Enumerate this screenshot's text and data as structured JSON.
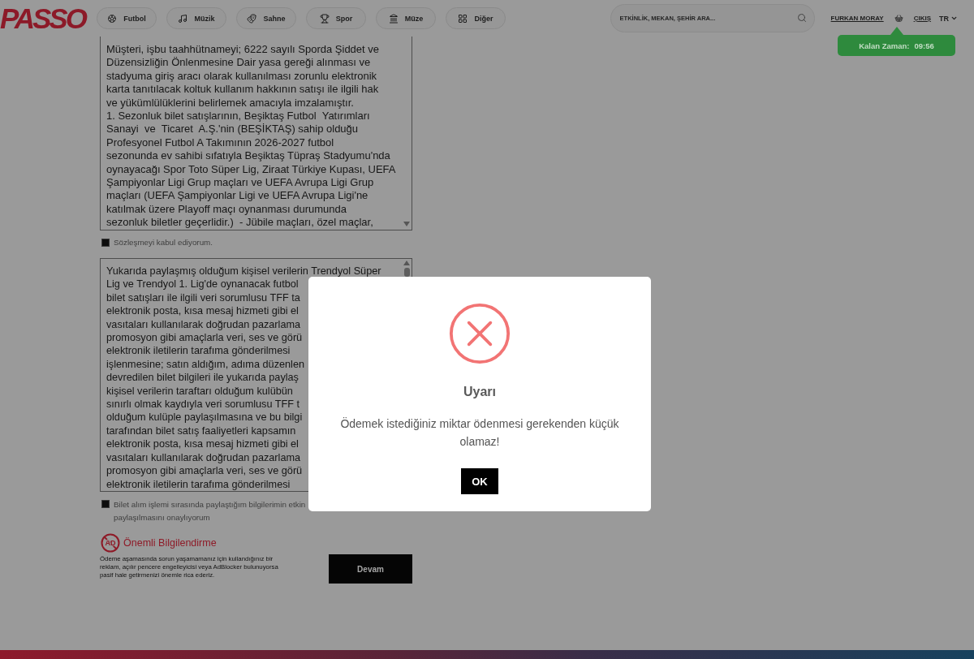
{
  "header": {
    "logo": "PASSO",
    "categories": [
      {
        "kind": "football",
        "label": "Futbol"
      },
      {
        "kind": "music",
        "label": "Müzik"
      },
      {
        "kind": "stage",
        "label": "Sahne"
      },
      {
        "kind": "sport",
        "label": "Spor"
      },
      {
        "kind": "museum",
        "label": "Müze"
      },
      {
        "kind": "other",
        "label": "Diğer"
      }
    ],
    "search": {
      "placeholder": "ETKİNLİK, MEKAN, ŞEHİR ARA..."
    },
    "user": "FURKAN MORAY",
    "logout": "ÇIKIŞ",
    "language": "TR"
  },
  "timer": {
    "label": "Kalan Zaman:",
    "value": "09:56"
  },
  "contract": {
    "lines": [
      "Müşteri, işbu taahhütnameyi; 6222 sayılı Sporda Şiddet ve",
      "Düzensizliğin Önlenmesine Dair yasa gereği alınması ve",
      "stadyuma giriş aracı olarak kullanılması zorunlu elektronik",
      "karta tanıtılacak koltuk kullanım hakkının satışı ile ilgili hak",
      "ve yükümlülüklerini belirlemek amacıyla imzalamıştır.",
      "1. Sezonluk bilet satışlarının, Beşiktaş Futbol  Yatırımları",
      "Sanayi  ve  Ticaret  A.Ş.'nin (BEŞİKTAŞ) sahip olduğu",
      "Profesyonel Futbol A Takımının 2026-2027 futbol",
      "sezonunda ev sahibi sıfatıyla Beşiktaş Tüpraş Stadyumu'nda",
      "oynayacağı Spor Toto Süper Lig, Ziraat Türkiye Kupası, UEFA",
      "Şampiyonlar Ligi Grup maçları ve UEFA Avrupa Ligi Grup",
      "maçları (UEFA Şampiyonlar Ligi ve UEFA Avrupa Ligi'ne",
      "katılmak üzere Playoff maçı oynanması durumunda",
      "sezonluk biletler geçerlidir.)  - Jübile maçları, özel maçlar,"
    ],
    "checkbox": {
      "label_lines": [
        "Sözleşmeyi kabul ediyorum."
      ],
      "checked": false
    }
  },
  "consent": {
    "lines": [
      "Yukarıda paylaşmış olduğum kişisel verilerin Trendyol Süper",
      "Lig ve Trendyol 1. Lig'de oynanacak futbol",
      "bilet satışları ile ilgili veri sorumlusu TFF ta",
      "elektronik posta, kısa mesaj hizmeti gibi el",
      "vasıtaları kullanılarak doğrudan pazarlama",
      "promosyon gibi amaçlarla veri, ses ve görü",
      "elektronik iletilerin tarafıma gönderilmesi",
      "işlenmesine; satın aldığım, adıma düzenlen",
      "devredilen bilet bilgileri ile yukarıda paylaş",
      "kişisel verilerin taraftarı olduğum kulübün",
      "sınırlı olmak kaydıyla veri sorumlusu TFF t",
      "olduğum kulüple paylaşılmasına ve bu bilgi",
      "tarafından bilet satış faaliyetleri kapsamın",
      "elektronik posta, kısa mesaj hizmeti gibi el",
      "vasıtaları kullanılarak doğrudan pazarlama",
      "promosyon gibi amaçlarla veri, ses ve görü",
      "elektronik iletilerin tarafıma gönderilmesi"
    ],
    "checkbox": {
      "label_lines": [
        "Bilet alım işlemi sırasında paylaştığım bilgilerimin etkin",
        "paylaşılmasını onaylıyorum"
      ],
      "checked": false
    }
  },
  "notice": {
    "icon_text": "AD",
    "title": "Önemli Bilgilendirme",
    "lines": [
      "Ödeme aşamasında sorun yaşamamanız için kullandığınız bir",
      "reklam, açılır pencere engelleyicisi veya AdBlocker bulunuyorsa",
      "pasif hale getirmenizi önemle rica ederiz."
    ]
  },
  "continue_button": "Devam",
  "dialog": {
    "title": "Uyarı",
    "message": "Ödemek istediğiniz miktar ödenmesi gerekenden küçük olamaz!",
    "button": "OK"
  }
}
